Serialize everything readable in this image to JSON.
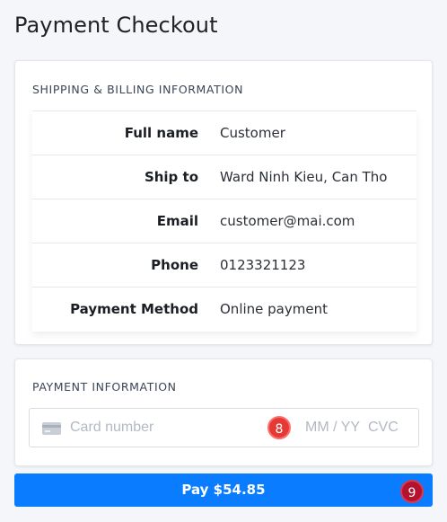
{
  "page": {
    "title": "Payment Checkout"
  },
  "shipping": {
    "section_title": "SHIPPING & BILLING INFORMATION",
    "rows": [
      {
        "label": "Full name",
        "value": "Customer"
      },
      {
        "label": "Ship to",
        "value": "Ward Ninh Kieu, Can Tho"
      },
      {
        "label": "Email",
        "value": "customer@mai.com"
      },
      {
        "label": "Phone",
        "value": "0123321123"
      },
      {
        "label": "Payment Method",
        "value": "Online payment"
      }
    ]
  },
  "payment": {
    "section_title": "PAYMENT INFORMATION",
    "card_number_placeholder": "Card number",
    "expiry_placeholder": "MM / YY",
    "cvc_placeholder": "CVC",
    "card_icon": "credit-card-icon"
  },
  "pay_button": {
    "label": "Pay $54.85",
    "color": "#0a7cff"
  },
  "markers": {
    "card_field": "8",
    "pay_button": "9"
  }
}
